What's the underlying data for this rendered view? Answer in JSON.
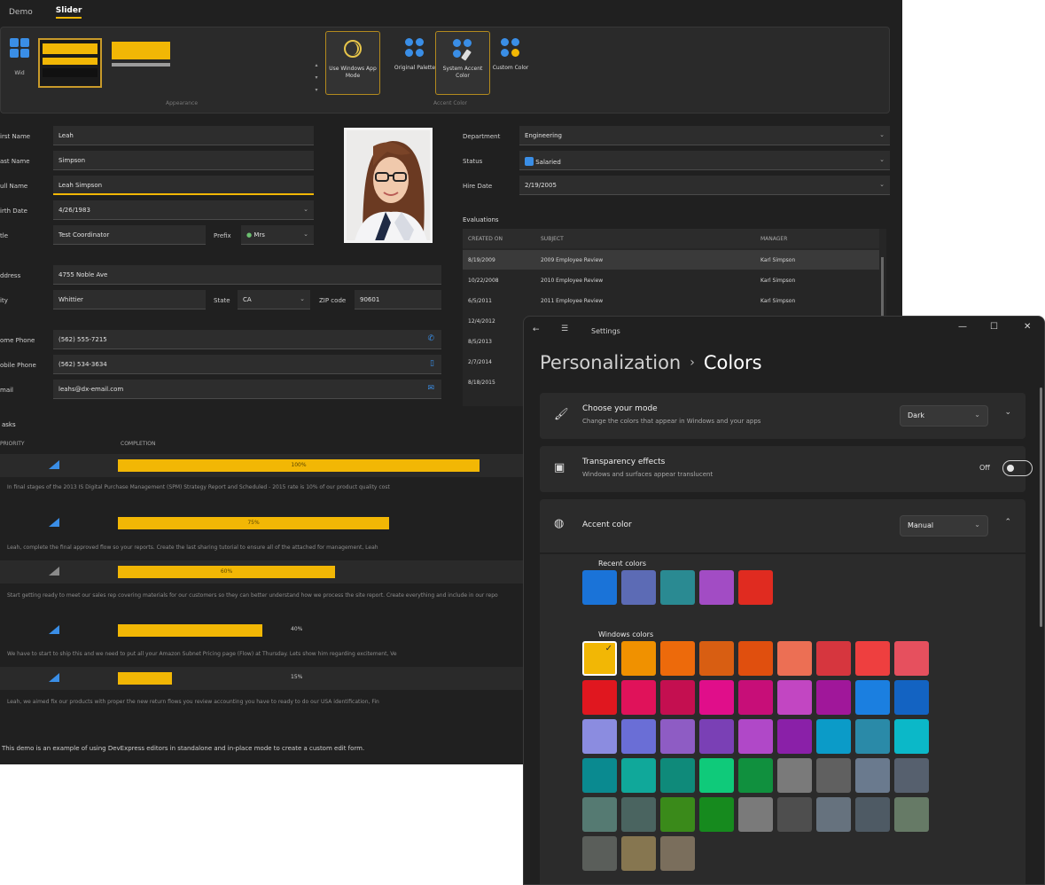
{
  "back_app": {
    "tabs": [
      "Demo",
      "Slider"
    ],
    "ribbon": {
      "left_label": "Wid",
      "scroll_glyphs": [
        "▴",
        "▾",
        "▾"
      ],
      "group_labels": [
        "Appearance",
        "Accent Color"
      ],
      "buttons": [
        {
          "label": "Use Windows App Mode"
        },
        {
          "label": "Original Palette"
        },
        {
          "label": "System Accent Color"
        },
        {
          "label": "Custom Color"
        }
      ]
    },
    "form": {
      "first_name_label": "irst Name",
      "first_name_value": "Leah",
      "last_name_label": "ast Name",
      "last_name_value": "Simpson",
      "full_name_label": "ull Name",
      "full_name_value": "Leah Simpson",
      "birth_date_label": "irth Date",
      "birth_date_value": "4/26/1983",
      "title_label": "tle",
      "title_value": "Test Coordinator",
      "prefix_label": "Prefix",
      "prefix_value": "Mrs",
      "address_label": "ddress",
      "address_value": "4755 Noble Ave",
      "city_label": "ity",
      "city_value": "Whittier",
      "state_label": "State",
      "state_value": "CA",
      "zip_label": "ZIP code",
      "zip_value": "90601",
      "home_phone_label": "ome Phone",
      "home_phone_value": "(562) 555-7215",
      "mobile_phone_label": "obile Phone",
      "mobile_phone_value": "(562) 534-3634",
      "email_label": "mail",
      "email_value": "leahs@dx-email.com",
      "department_label": "Department",
      "department_value": "Engineering",
      "status_label": "Status",
      "status_value": "Salaried",
      "hire_date_label": "Hire Date",
      "hire_date_value": "2/19/2005"
    },
    "evaluations": {
      "title": "Evaluations",
      "headers": [
        "CREATED ON",
        "SUBJECT",
        "MANAGER"
      ],
      "rows": [
        [
          "8/19/2009",
          "2009 Employee Review",
          "Karl Simpson"
        ],
        [
          "10/22/2008",
          "2010 Employee Review",
          "Karl Simpson"
        ],
        [
          "6/5/2011",
          "2011 Employee Review",
          "Karl Simpson"
        ],
        [
          "12/4/2012",
          "",
          ""
        ],
        [
          "8/5/2013",
          "",
          ""
        ],
        [
          "2/7/2014",
          "",
          ""
        ],
        [
          "8/18/2015",
          "",
          ""
        ]
      ]
    },
    "tasks": {
      "title": "asks",
      "headers": [
        "PRIORITY",
        "COMPLETION"
      ],
      "rows": [
        {
          "pct": "100%",
          "fill": 1.0,
          "desc": "In final stages of the 2013 IS Digital Purchase Management (SPM) Strategy Report and Scheduled - 2015 rate is 10% of our product quality cost"
        },
        {
          "pct": "75%",
          "fill": 0.75,
          "desc": "Leah, complete the final approved flow so your reports. Create the last sharing tutorial to ensure all of the attached for management, Leah"
        },
        {
          "pct": "60%",
          "fill": 0.6,
          "desc": "Start getting ready to meet our sales rep covering materials for our customers so they can better understand how we process the site report. Create everything and include in our repo"
        },
        {
          "pct": "40%",
          "fill": 0.4,
          "desc": "We have to start to ship this and we need to put all your Amazon Subnet Pricing page (Flow) at Thursday. Lets show him regarding excitement, Ve"
        },
        {
          "pct": "15%",
          "fill": 0.15,
          "desc": "Leah, we aimed fix our products with proper the new return flows you review accounting you have to ready to do our USA identification, Fin"
        }
      ]
    },
    "footer": "This demo is an example of using DevExpress editors in standalone and in-place mode to create a custom edit form."
  },
  "settings": {
    "window_title": "Settings",
    "back_glyph": "←",
    "menu_glyph": "☰",
    "controls": [
      "—",
      "☐",
      "✕"
    ],
    "crumb_parent": "Personalization",
    "crumb_sep": "›",
    "crumb_current": "Colors",
    "mode_card": {
      "title": "Choose your mode",
      "desc": "Change the colors that appear in Windows and your apps",
      "value": "Dark"
    },
    "transparency_card": {
      "title": "Transparency effects",
      "desc": "Windows and surfaces appear translucent",
      "state": "Off"
    },
    "accent_card": {
      "title": "Accent color",
      "value": "Manual"
    },
    "recent_label": "Recent colors",
    "windows_label": "Windows colors",
    "recent_colors": [
      "#1a73d8",
      "#5c6bb5",
      "#2a8a92",
      "#a24cc4",
      "#e02b20"
    ],
    "windows_colors": [
      [
        "#f2b705",
        "#f09100",
        "#ed6a0b",
        "#d85e12",
        "#e04f0e",
        "#ec6f54",
        "#d6363e",
        "#ee3f3f",
        "#e6505e"
      ],
      [
        "#e0171f",
        "#e0125a",
        "#c40f50",
        "#e00e8a",
        "#c70e78",
        "#c246c2",
        "#a0179a",
        "#1b7fe0",
        "#1363c2"
      ],
      [
        "#8b8ce0",
        "#6a6ed6",
        "#8e5cc4",
        "#7a40b5",
        "#b048c8",
        "#8a20a8",
        "#0b9bc8",
        "#2a8aa8",
        "#0bb8c8"
      ],
      [
        "#0a8a90",
        "#10a89a",
        "#0f8a7a",
        "#0fca7a",
        "#10903e",
        "#7a7a7a",
        "#606060",
        "#6a7a8e",
        "#56606e"
      ],
      [
        "#557a72",
        "#4a6460",
        "#3a8a1a",
        "#168a1e",
        "#7a7a7a",
        "#4e4e4e",
        "#66727e",
        "#4e5a64",
        "#667a66"
      ],
      [
        "#5a5e5a",
        "#867650",
        "#7a6e5c"
      ]
    ],
    "selected_color": "#f2b705",
    "check_glyph": "✓"
  }
}
